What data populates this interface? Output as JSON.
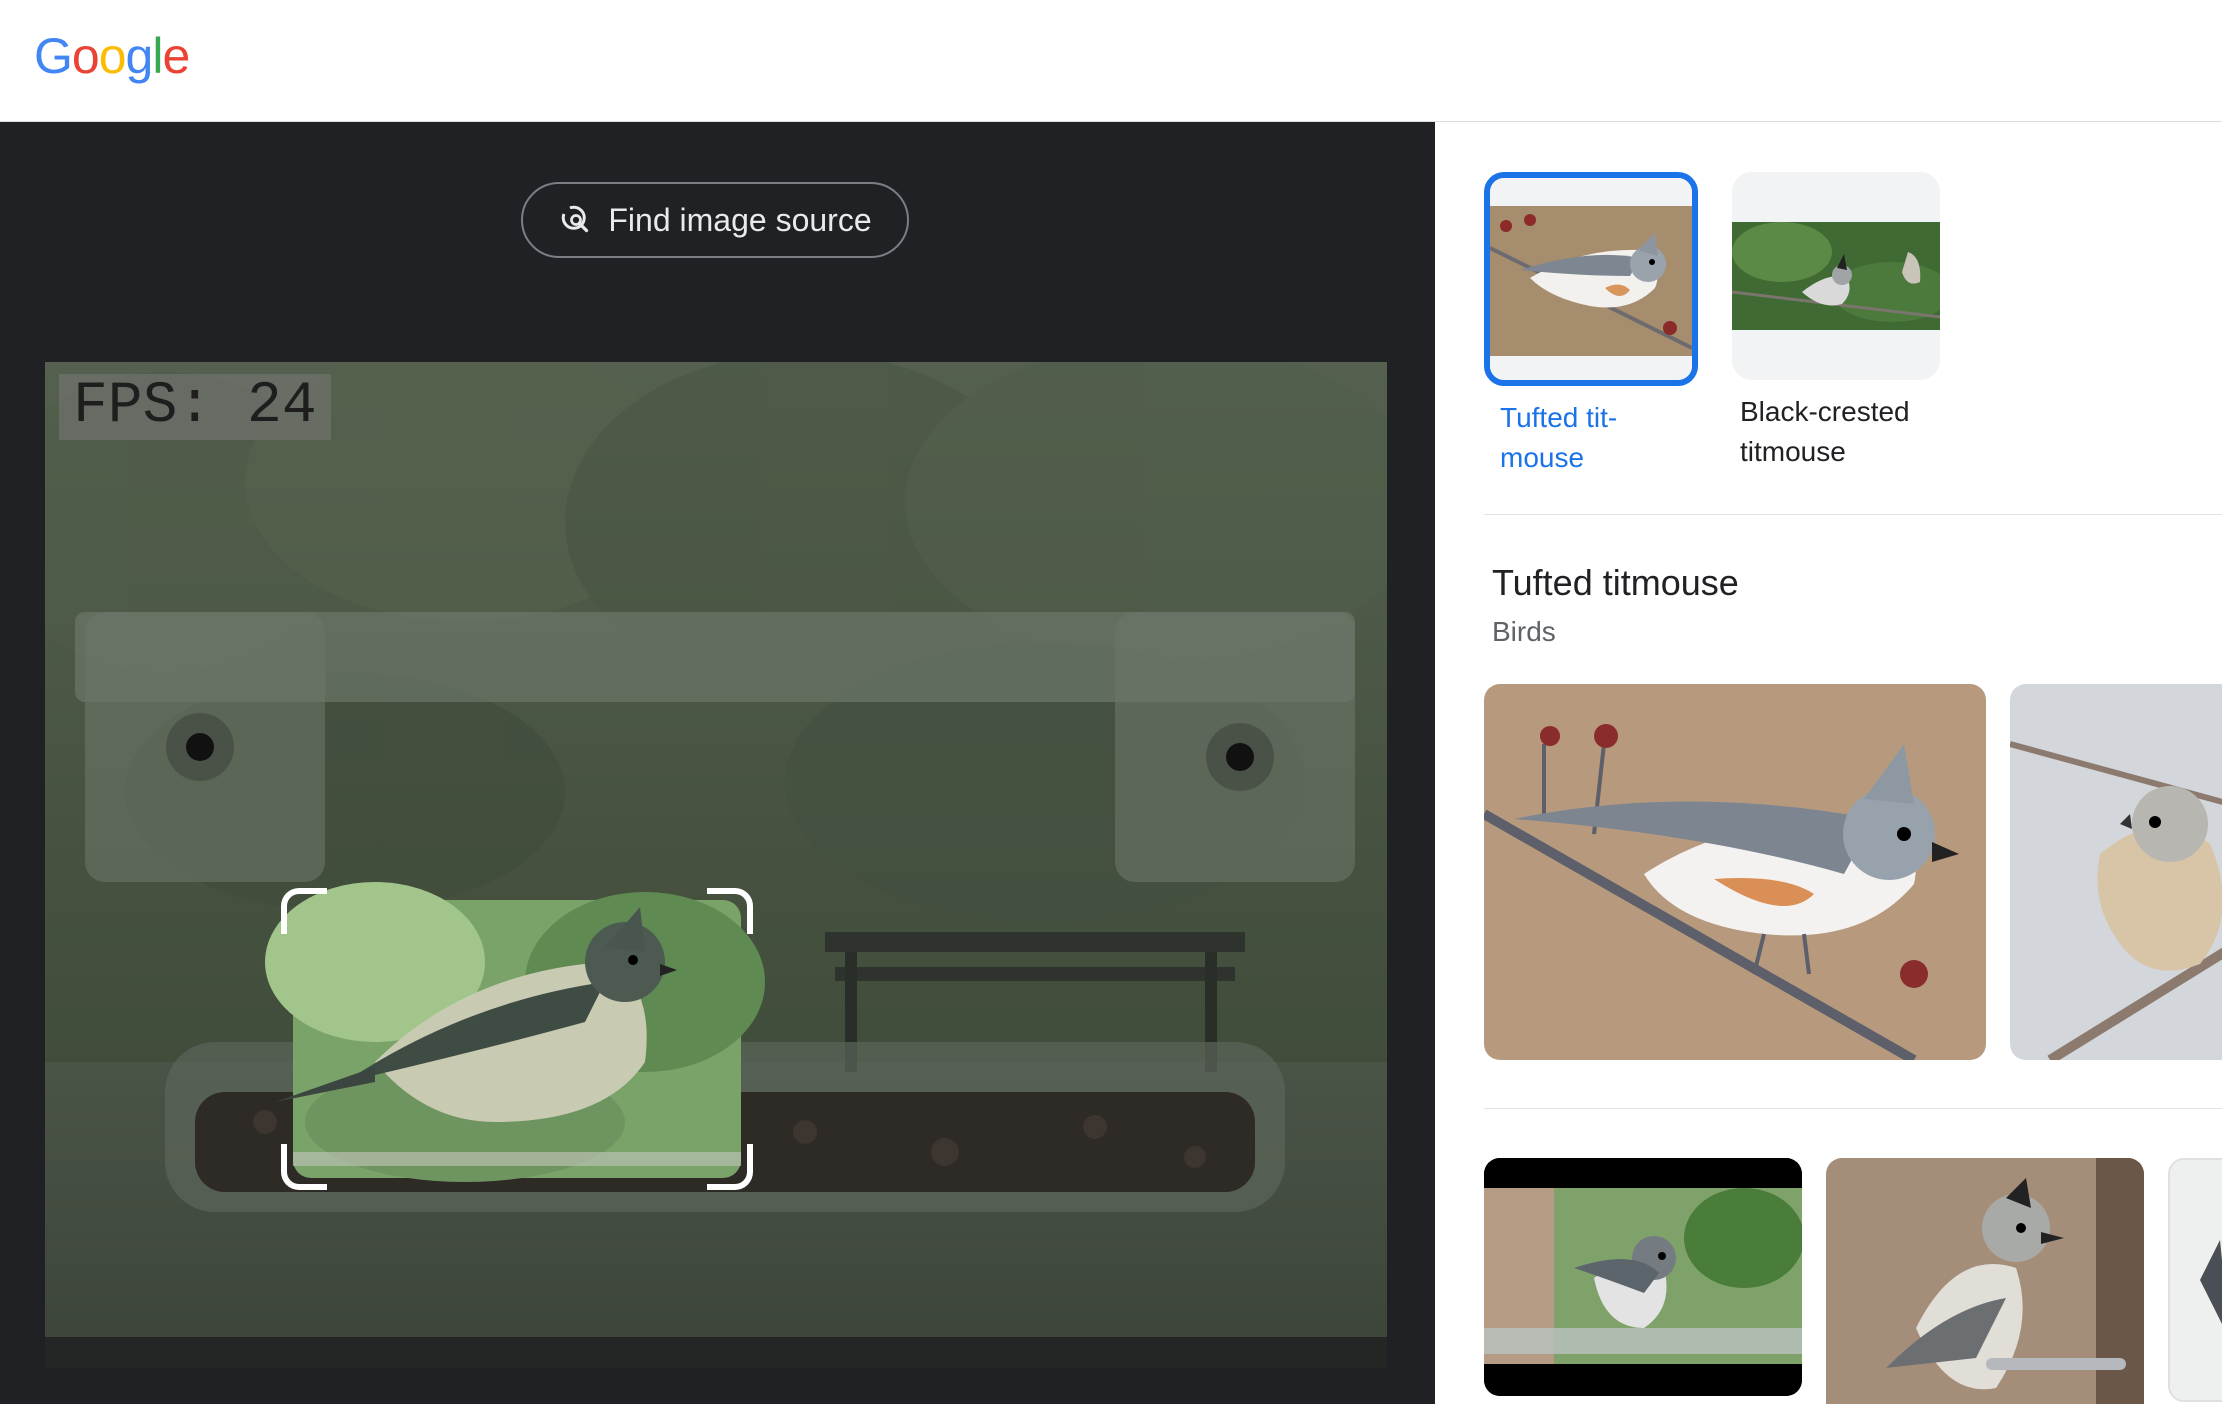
{
  "header": {
    "logo_text": [
      "G",
      "o",
      "o",
      "g",
      "l",
      "e"
    ],
    "logo_colors": [
      "#4285F4",
      "#EA4335",
      "#FBBC05",
      "#4285F4",
      "#34A853",
      "#EA4335"
    ]
  },
  "left_pane": {
    "find_source_label": "Find image source",
    "photo_overlay_text": "FPS: 24"
  },
  "chips": [
    {
      "label_line1": "Tufted tit-",
      "label_line2": "mouse",
      "selected": true
    },
    {
      "label_line1": "Black-crested",
      "label_line2": "titmouse",
      "selected": false
    }
  ],
  "entity": {
    "title": "Tufted titmouse",
    "category": "Birds"
  },
  "colors": {
    "accent": "#1a73e8",
    "dark_bg": "#202124",
    "text_primary": "#202124",
    "text_secondary": "#5f6368"
  },
  "icons": {
    "find_source": "lens-search-icon"
  }
}
